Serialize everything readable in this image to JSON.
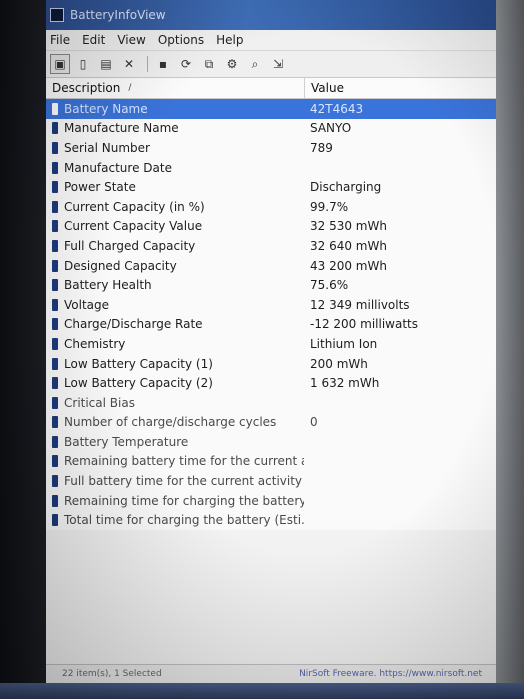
{
  "window": {
    "title": "BatteryInfoView"
  },
  "menu": [
    "File",
    "Edit",
    "View",
    "Options",
    "Help"
  ],
  "toolbar": [
    {
      "name": "properties-icon",
      "glyph": "▣"
    },
    {
      "name": "copy-icon",
      "glyph": "▯"
    },
    {
      "name": "html-report-icon",
      "glyph": "▤"
    },
    {
      "name": "delete-icon",
      "glyph": "✕"
    },
    {
      "name": "save-icon",
      "glyph": "▪"
    },
    {
      "name": "refresh-icon",
      "glyph": "⟳"
    },
    {
      "name": "copy-selected-icon",
      "glyph": "⧉"
    },
    {
      "name": "options-icon",
      "glyph": "⚙"
    },
    {
      "name": "find-icon",
      "glyph": "⌕"
    },
    {
      "name": "exit-icon",
      "glyph": "⇲"
    }
  ],
  "columns": {
    "description": "Description",
    "value": "Value"
  },
  "rows": [
    {
      "d": "Battery Name",
      "v": "42T4643"
    },
    {
      "d": "Manufacture Name",
      "v": "SANYO"
    },
    {
      "d": "Serial Number",
      "v": "789"
    },
    {
      "d": "Manufacture Date",
      "v": ""
    },
    {
      "d": "Power State",
      "v": "Discharging"
    },
    {
      "d": "Current Capacity (in %)",
      "v": "99.7%"
    },
    {
      "d": "Current Capacity Value",
      "v": "32 530 mWh"
    },
    {
      "d": "Full Charged Capacity",
      "v": "32 640 mWh"
    },
    {
      "d": "Designed Capacity",
      "v": "43 200 mWh"
    },
    {
      "d": "Battery Health",
      "v": "75.6%"
    },
    {
      "d": "Voltage",
      "v": "12 349 millivolts"
    },
    {
      "d": "Charge/Discharge Rate",
      "v": "-12 200 milliwatts"
    },
    {
      "d": "Chemistry",
      "v": "Lithium Ion"
    },
    {
      "d": "Low Battery Capacity (1)",
      "v": "200 mWh"
    },
    {
      "d": "Low Battery Capacity (2)",
      "v": "1 632 mWh"
    },
    {
      "d": "Critical Bias",
      "v": ""
    },
    {
      "d": "Number of charge/discharge cycles",
      "v": "0"
    },
    {
      "d": "Battery Temperature",
      "v": ""
    },
    {
      "d": "Remaining battery time for the current a...",
      "v": ""
    },
    {
      "d": "Full battery time for the current activity (...",
      "v": ""
    },
    {
      "d": "Remaining time for charging the battery...",
      "v": ""
    },
    {
      "d": "Total  time for charging the battery (Esti...",
      "v": ""
    }
  ],
  "selected_row": 0,
  "status": {
    "items": "22 item(s), 1 Selected",
    "credit": "NirSoft Freeware. https://www.nirsoft.net"
  }
}
